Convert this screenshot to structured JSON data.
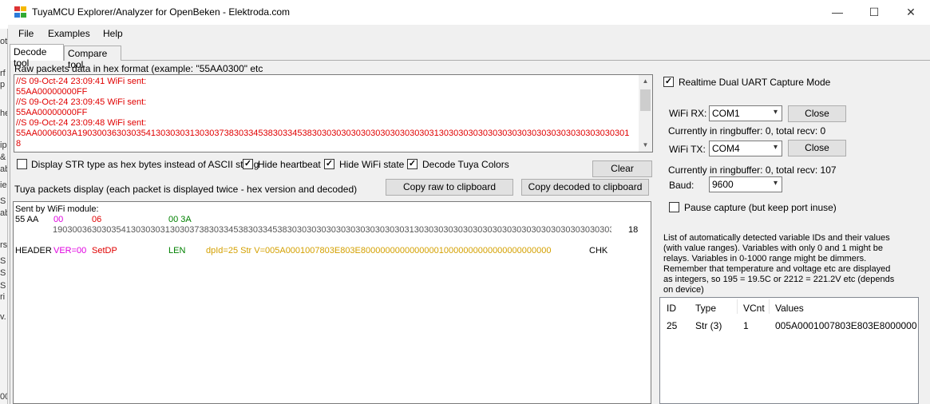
{
  "window": {
    "title": "TuyaMCU Explorer/Analyzer for OpenBeken - Elektroda.com",
    "minimize": "—",
    "maximize": "☐",
    "close": "✕"
  },
  "menu": [
    "File",
    "Examples",
    "Help"
  ],
  "tabs": [
    "Decode tool",
    "Compare tool"
  ],
  "raw": {
    "label": "Raw packets data in hex format (example: \"55AA0300\" etc",
    "lines": [
      "//S 09-Oct-24 23:09:41 WiFi sent:",
      "55AA00000000FF",
      "//S 09-Oct-24 23:09:45 WiFi sent:",
      "55AA00000000FF",
      "//S 09-Oct-24 23:09:48 WiFi sent:",
      "55AA0006003A19030036303035413030303130303738303345383033453830303030303030303030303031303030303030303030303030303030303030301",
      "8"
    ]
  },
  "options": {
    "hex_str": "Display STR type as hex bytes instead of ASCII string",
    "hide_heartbeat": "Hide heartbeat",
    "hide_wifi": "Hide WiFi state",
    "decode_colors": "Decode Tuya Colors",
    "clear": "Clear"
  },
  "display": {
    "label": "Tuya packets display (each packet is displayed twice - hex version and decoded)",
    "copy_raw": "Copy raw to clipboard",
    "copy_decoded": "Copy decoded to clipboard",
    "sent_by": "Sent by WiFi module:",
    "hex_header": "55 AA",
    "hex_ver": "00",
    "hex_cmd": "06",
    "hex_len": "00 3A",
    "hex_payload": "19030036303035413030303130303738303345383033453830303030303030303030303031303030303030303030303030303030303030303030",
    "hex_chk": "18",
    "dec_header": "HEADER",
    "dec_ver": "VER=00",
    "dec_cmd": "SetDP",
    "dec_len": "LEN",
    "dec_payload": "dpId=25 Str V=005A0001007803E803E800000000000000010000000000000000000000",
    "dec_chk": "CHK"
  },
  "capture": {
    "realtime_label": "Realtime Dual UART Capture Mode",
    "wifi_rx_label": "WiFi RX:",
    "wifi_rx_port": "COM1",
    "rx_close": "Close",
    "rx_status": "Currently in ringbuffer: 0, total recv: 0",
    "wifi_tx_label": "WiFi TX:",
    "wifi_tx_port": "COM4",
    "tx_close": "Close",
    "tx_status": "Currently in ringbuffer: 0, total recv: 107",
    "baud_label": "Baud:",
    "baud_value": "9600",
    "pause_label": "Pause capture (but keep port inuse)"
  },
  "vars": {
    "description": "List of automatically detected variable IDs  and their values (with value ranges). Variables with only 0 and 1 might be relays. Variables in 0-1000 range might be dimmers. Remember that temperature and voltage etc are displayed as integers, so 195 = 19.5C or 2212 = 221.2V etc (depends on device)",
    "columns": [
      "ID",
      "Type",
      "VCnt",
      "Values"
    ],
    "rows": [
      {
        "id": "25",
        "type": "Str (3)",
        "vcnt": "1",
        "values": "005A0001007803E803E8000000..."
      }
    ]
  },
  "colors": {
    "raw_text": "#e00000",
    "ver": "#e000e0",
    "cmd": "#e00000",
    "len": "#008000",
    "payload": "#d4a000"
  }
}
